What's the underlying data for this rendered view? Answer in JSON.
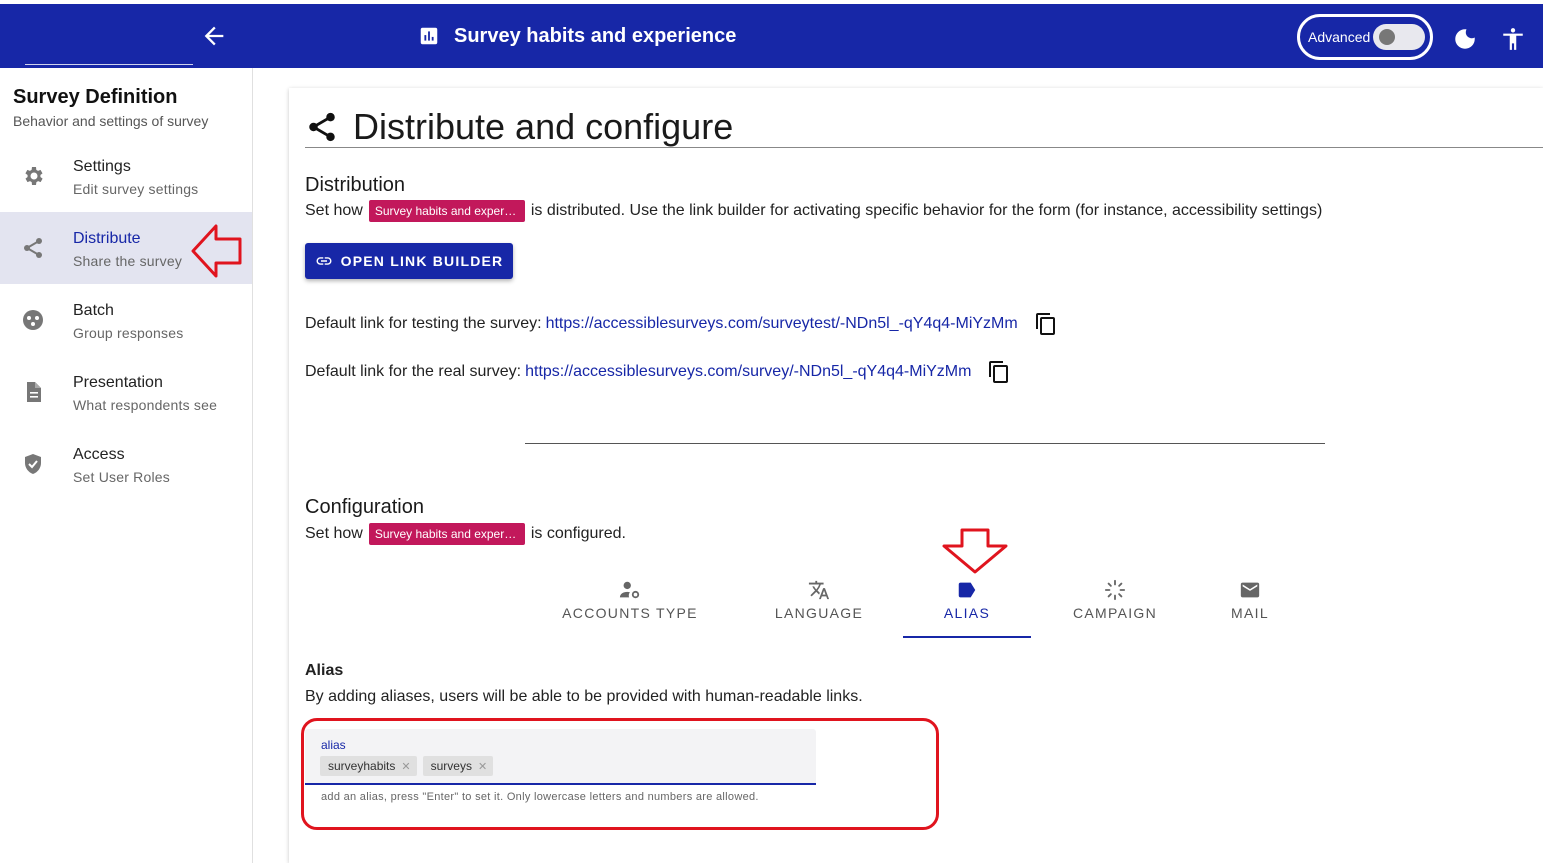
{
  "appbar": {
    "title": "Survey habits and experience",
    "advanced_label": "Advanced",
    "brand_color": "#1727a7"
  },
  "sidebar": {
    "title": "Survey Definition",
    "subtitle": "Behavior and settings of survey",
    "items": [
      {
        "label": "Settings",
        "sub": "Edit survey settings",
        "icon": "gear-icon"
      },
      {
        "label": "Distribute",
        "sub": "Share the survey",
        "icon": "share-icon",
        "active": true
      },
      {
        "label": "Batch",
        "sub": "Group responses",
        "icon": "batch-icon"
      },
      {
        "label": "Presentation",
        "sub": "What respondents see",
        "icon": "document-icon"
      },
      {
        "label": "Access",
        "sub": "Set User Roles",
        "icon": "shield-icon"
      }
    ]
  },
  "main": {
    "heading": "Distribute and configure",
    "distribution": {
      "title": "Distribution",
      "text_before": "Set how",
      "survey_chip": "Survey habits and experie...",
      "text_after": "is distributed. Use the link builder for activating specific behavior for the form (for instance, accessibility settings)",
      "button": "OPEN LINK BUILDER",
      "test_label": "Default link for testing the survey:",
      "test_url": "https://accessiblesurveys.com/surveytest/-NDn5l_-qY4q4-MiYzMm",
      "real_label": "Default link for the real survey:",
      "real_url": "https://accessiblesurveys.com/survey/-NDn5l_-qY4q4-MiYzMm"
    },
    "configuration": {
      "title": "Configuration",
      "text_before": "Set how",
      "survey_chip": "Survey habits and experie...",
      "text_after": "is configured."
    },
    "tabs": [
      {
        "label": "ACCOUNTS TYPE",
        "icon": "account-settings-icon"
      },
      {
        "label": "LANGUAGE",
        "icon": "translate-icon"
      },
      {
        "label": "ALIAS",
        "icon": "label-icon",
        "active": true
      },
      {
        "label": "CAMPAIGN",
        "icon": "campaign-icon"
      },
      {
        "label": "MAIL",
        "icon": "mail-icon"
      }
    ],
    "alias": {
      "title": "Alias",
      "description": "By adding aliases, users will be able to be provided with human-readable links.",
      "field_label": "alias",
      "chips": [
        "surveyhabits",
        "surveys"
      ],
      "hint": "add an alias, press \"Enter\" to set it. Only lowercase letters and numbers are allowed."
    }
  },
  "colors": {
    "accent": "#1727a7",
    "chip": "#c2185b",
    "annotation": "#e0141e"
  }
}
